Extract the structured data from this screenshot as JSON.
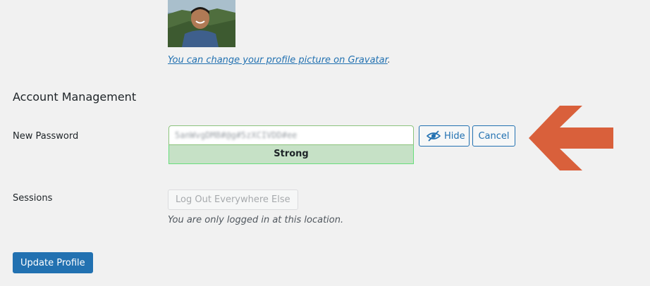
{
  "profile_picture": {
    "link_text": "You can change your profile picture on Gravatar",
    "suffix": "."
  },
  "account_management": {
    "title": "Account Management",
    "new_password": {
      "label": "New Password",
      "value": "5anWvgDM8#@g#5zXCIVDD#ee",
      "strength": "Strong",
      "hide_label": "Hide",
      "cancel_label": "Cancel"
    },
    "sessions": {
      "label": "Sessions",
      "button_label": "Log Out Everywhere Else",
      "description": "You are only logged in at this location."
    }
  },
  "submit": {
    "label": "Update Profile"
  },
  "icons": {
    "hide_button_icon": "eye-slash-icon",
    "callout_arrow": "left-arrow-icon"
  },
  "colors": {
    "accent": "#2271b1",
    "strong_meter": "#c6e1c6",
    "arrow": "#d9603b",
    "background": "#f1f1f1"
  }
}
